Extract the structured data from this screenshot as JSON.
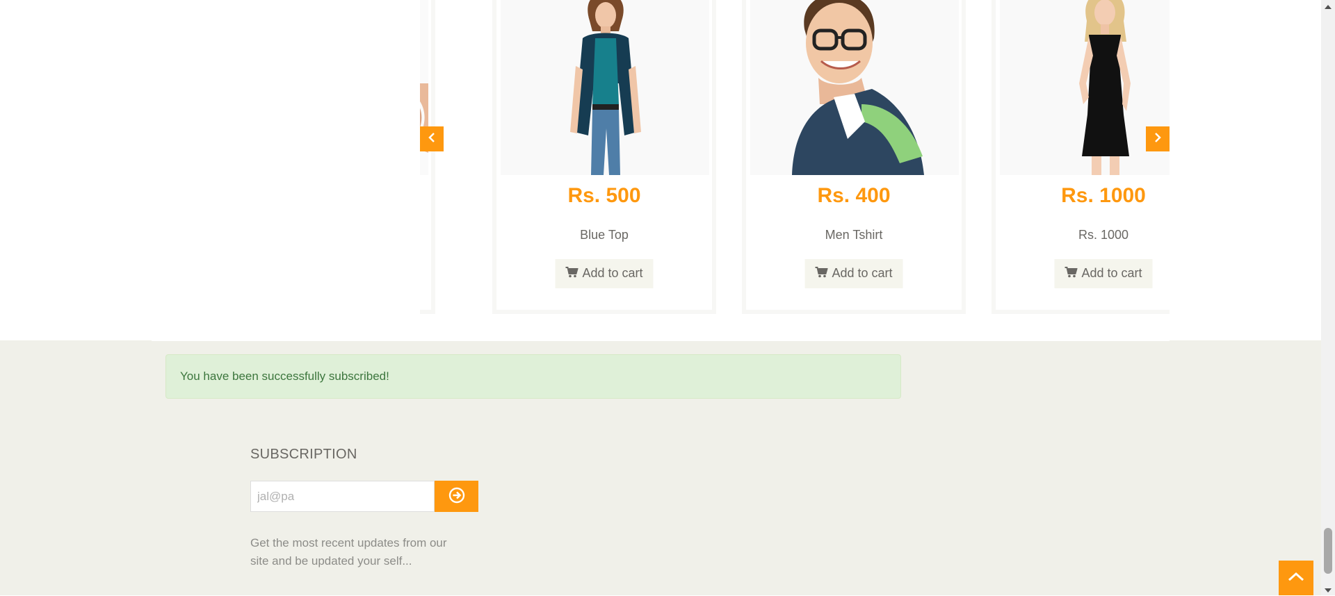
{
  "products": [
    {
      "price": "",
      "name": "",
      "cart_label": ""
    },
    {
      "price": "Rs. 500",
      "name": "Blue Top",
      "cart_label": "Add to cart"
    },
    {
      "price": "Rs. 400",
      "name": "Men Tshirt",
      "cart_label": "Add to cart"
    },
    {
      "price": "Rs. 1000",
      "name": "Rs. 1000",
      "cart_label": "Add to cart"
    }
  ],
  "alert": {
    "message": "You have been successfully subscribed!"
  },
  "subscription": {
    "title": "SUBSCRIPTION",
    "email_value": "jal@pa",
    "description": "Get the most recent updates from our site and be updated your self..."
  },
  "colors": {
    "accent": "#fe980f",
    "footer_bg": "#f0f0e9",
    "alert_bg": "#dff0d8",
    "alert_text": "#3c763d"
  },
  "icons": {
    "cart": "shopping-cart-icon",
    "prev": "chevron-left-icon",
    "next": "chevron-right-icon",
    "submit": "circle-arrow-right-icon",
    "scroll_up": "chevron-up-icon"
  }
}
